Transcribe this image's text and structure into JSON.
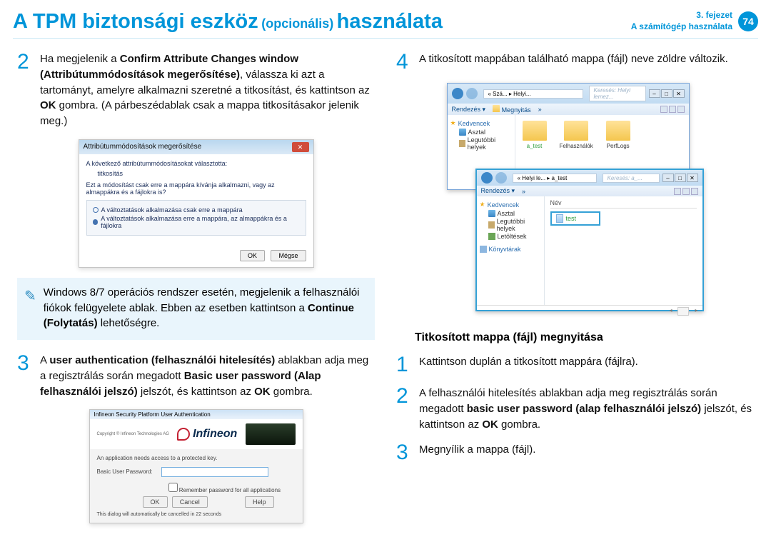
{
  "header": {
    "title_main": "A TPM biztonsági eszköz",
    "title_optional": "(opcionális)",
    "title_after": "használata",
    "chapter": "3. fejezet",
    "section": "A számítógép használata",
    "page": "74"
  },
  "left": {
    "step2": {
      "num": "2",
      "t1": "Ha megjelenik a ",
      "b1": "Confirm Attribute Changes window (Attribútummódosítások megerősítése)",
      "t2": ", válassza ki azt a tartományt, amelyre alkalmazni szeretné a titkosítást, és kattintson az ",
      "b2": "OK",
      "t3": " gombra. (A párbeszédablak csak a mappa titkosításakor jelenik meg.)"
    },
    "shot1": {
      "title": "Attribútummódosítások megerősítése",
      "line1": "A következő attribútummódosításokat választotta:",
      "attr": "titkosítás",
      "line2": "Ezt a módosítást csak erre a mappára kívánja alkalmazni, vagy az almappákra és a fájlokra is?",
      "opt1": "A változtatások alkalmazása csak erre a mappára",
      "opt2": "A változtatások alkalmazása erre a mappára, az almappákra és a fájlokra",
      "ok": "OK",
      "cancel": "Mégse"
    },
    "note": {
      "t1": "Windows 8/7 operációs rendszer esetén, megjelenik a felhasználói fiókok felügyelete ablak. Ebben az esetben kattintson a ",
      "b1": "Continue (Folytatás)",
      "t2": " lehetőségre."
    },
    "step3": {
      "num": "3",
      "t1": "A ",
      "b1": "user authentication (felhasználói hitelesítés)",
      "t2": " ablakban adja meg a regisztrálás során megadott ",
      "b2": "Basic user password (Alap felhasználói jelszó)",
      "t3": " jelszót, és kattintson az ",
      "b3": "OK",
      "t4": " gombra."
    },
    "shot2": {
      "title": "Infineon Security Platform User Authentication",
      "logo": "Infineon",
      "msg": "An application needs access to a protected key.",
      "label": "Basic User Password:",
      "chk": "Remember password for all applications",
      "ok": "OK",
      "cancel": "Cancel",
      "help": "Help",
      "footer": "This dialog will automatically be cancelled in 22 seconds",
      "copyright": "Copyright ©\nInfineon Technologies AG"
    }
  },
  "right": {
    "step4": {
      "num": "4",
      "text": "A titkosított mappában található mappa (fájl) neve zöldre változik."
    },
    "explorer": {
      "crumb_a": "« Szá... ▸ Helyi...",
      "search_a": "Keresés: Helyi lemez...",
      "rendezes": "Rendezés ▾",
      "megnyitas": "Megnyitás",
      "kedvencek": "Kedvencek",
      "asztal": "Asztal",
      "legutobbi": "Legutóbbi helyek",
      "letoltesek": "Letöltések",
      "konyvtarak": "Könyvtárak",
      "file_a": "a_test",
      "file_b": "Felhasználók",
      "file_c": "PerfLogs",
      "crumb_b": "« Helyi le... ▸ a_test",
      "search_b": "Keresés: a_...",
      "nev": "Név",
      "test": "test"
    },
    "subheading": "Titkosított mappa (fájl) megnyitása",
    "open1": {
      "num": "1",
      "text": "Kattintson duplán a titkosított mappára (fájlra)."
    },
    "open2": {
      "num": "2",
      "t1": "A felhasználói hitelesítés ablakban adja meg regisztrálás során megadott ",
      "b1": "basic user password (alap felhasználói jelszó)",
      "t2": " jelszót, és kattintson az ",
      "b2": "OK",
      "t3": " gombra."
    },
    "open3": {
      "num": "3",
      "text": "Megnyílik a mappa (fájl)."
    }
  }
}
